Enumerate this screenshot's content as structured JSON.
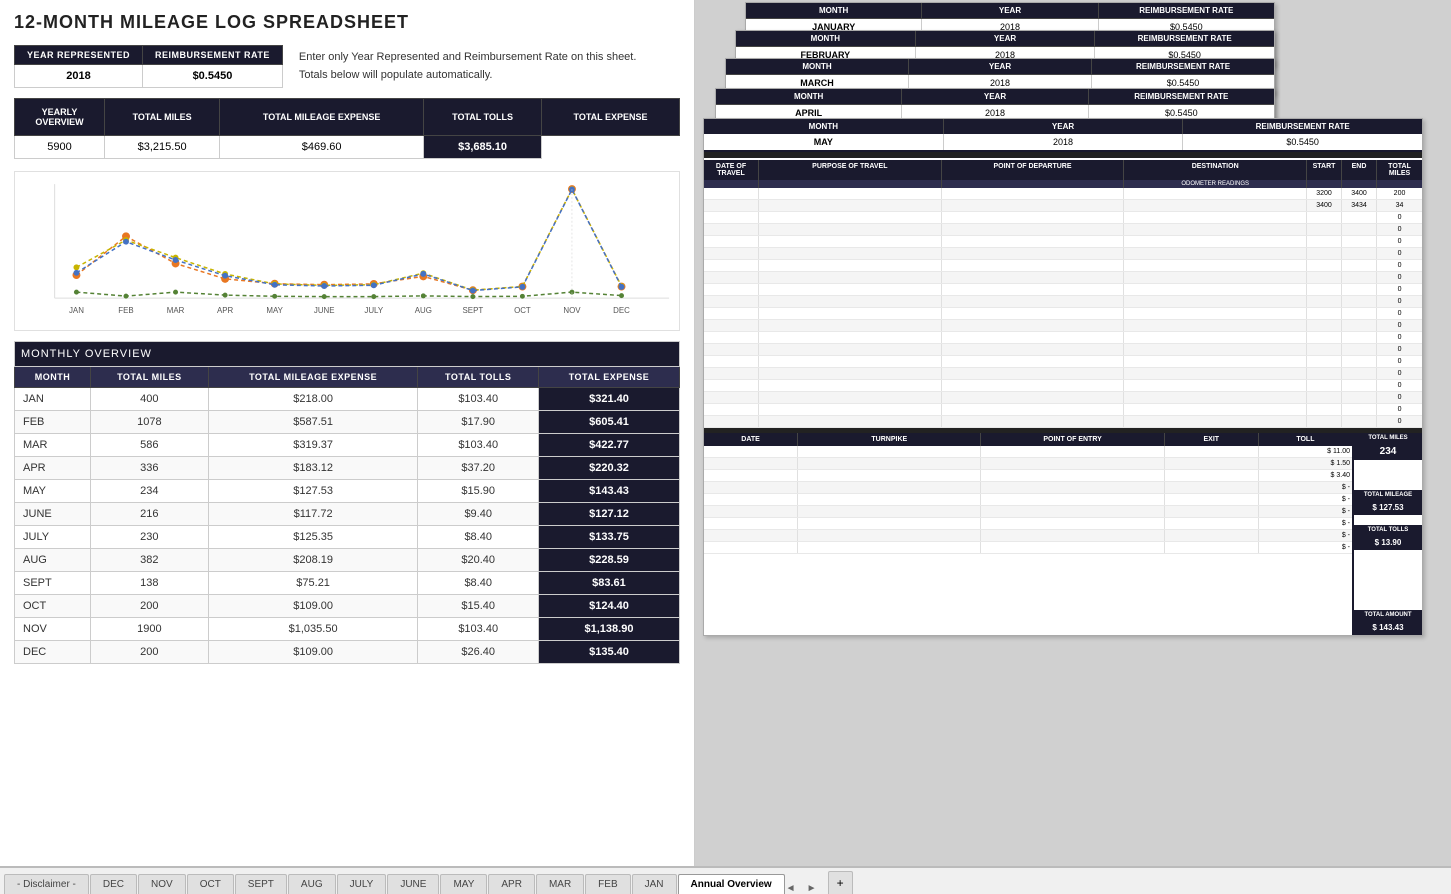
{
  "title": "12-MONTH MILEAGE LOG SPREADSHEET",
  "topInfo": {
    "yearLabel": "YEAR REPRESENTED",
    "reimbLabel": "REIMBURSEMENT RATE",
    "yearValue": "2018",
    "reimbValue": "$0.5450",
    "infoLine1": "Enter only Year Represented and Reimbursement Rate on this sheet.",
    "infoLine2": "Totals below will populate automatically."
  },
  "yearlyOverview": {
    "headers": [
      "TOTAL MILES",
      "TOTAL MILEAGE EXPENSE",
      "TOTAL TOLLS",
      "TOTAL EXPENSE"
    ],
    "rowLabel": "YEARLY OVERVIEW",
    "values": [
      "5900",
      "$3,215.50",
      "$469.60",
      "$3,685.10"
    ]
  },
  "monthlyOverview": {
    "sectionTitle": "MONTHLY OVERVIEW",
    "headers": [
      "MONTH",
      "TOTAL MILES",
      "TOTAL MILEAGE EXPENSE",
      "TOTAL TOLLS",
      "TOTAL EXPENSE"
    ],
    "rows": [
      [
        "JAN",
        "400",
        "$218.00",
        "$103.40",
        "$321.40"
      ],
      [
        "FEB",
        "1078",
        "$587.51",
        "$17.90",
        "$605.41"
      ],
      [
        "MAR",
        "586",
        "$319.37",
        "$103.40",
        "$422.77"
      ],
      [
        "APR",
        "336",
        "$183.12",
        "$37.20",
        "$220.32"
      ],
      [
        "MAY",
        "234",
        "$127.53",
        "$15.90",
        "$143.43"
      ],
      [
        "JUNE",
        "216",
        "$117.72",
        "$9.40",
        "$127.12"
      ],
      [
        "JULY",
        "230",
        "$125.35",
        "$8.40",
        "$133.75"
      ],
      [
        "AUG",
        "382",
        "$208.19",
        "$20.40",
        "$228.59"
      ],
      [
        "SEPT",
        "138",
        "$75.21",
        "$8.40",
        "$83.61"
      ],
      [
        "OCT",
        "200",
        "$109.00",
        "$15.40",
        "$124.40"
      ],
      [
        "NOV",
        "1900",
        "$1,035.50",
        "$103.40",
        "$1,138.90"
      ],
      [
        "DEC",
        "200",
        "$109.00",
        "$26.40",
        "$135.40"
      ]
    ]
  },
  "chart": {
    "months": [
      "JAN",
      "FEB",
      "MAR",
      "APR",
      "MAY",
      "JUNE",
      "JULY",
      "AUG",
      "SEPT",
      "OCT",
      "NOV",
      "DEC"
    ],
    "totalMiles": [
      400,
      1078,
      586,
      336,
      234,
      216,
      230,
      382,
      138,
      200,
      1900,
      200
    ],
    "totalMileageExpense": [
      218.0,
      587.51,
      319.37,
      183.12,
      127.53,
      117.72,
      125.35,
      208.19,
      75.21,
      109.0,
      1035.5,
      109.0
    ],
    "totalTolls": [
      103.4,
      17.9,
      103.4,
      37.2,
      15.9,
      9.4,
      8.4,
      20.4,
      8.4,
      15.4,
      103.4,
      26.4
    ],
    "totalExpense": [
      321.4,
      605.41,
      422.77,
      220.32,
      143.43,
      127.12,
      133.75,
      228.59,
      83.61,
      124.4,
      1138.9,
      135.4
    ]
  },
  "monthSheets": [
    {
      "month": "JANUARY",
      "year": "2018",
      "rate": "$0.5450"
    },
    {
      "month": "FEBRUARY",
      "year": "2018",
      "rate": "$0.5450"
    },
    {
      "month": "MARCH",
      "year": "2018",
      "rate": "$0.5450"
    },
    {
      "month": "APRIL",
      "year": "2018",
      "rate": "$0.5450"
    },
    {
      "month": "MAY",
      "year": "2018",
      "rate": "$0.5450",
      "travelHeaders": [
        "DATE OF TRAVEL",
        "PURPOSE OF TRAVEL",
        "POINT OF DEPARTURE",
        "DESTINATION",
        "START",
        "END",
        "TOTAL MILES"
      ],
      "travelRows": [
        [
          "",
          "",
          "",
          "",
          "3200",
          "3400",
          "200"
        ],
        [
          "",
          "",
          "",
          "",
          "3400",
          "3434",
          "34"
        ],
        [
          "",
          "",
          "",
          "",
          "",
          "",
          "0"
        ],
        [
          "",
          "",
          "",
          "",
          "",
          "",
          "0"
        ],
        [
          "",
          "",
          "",
          "",
          "",
          "",
          "0"
        ],
        [
          "",
          "",
          "",
          "",
          "",
          "",
          "0"
        ],
        [
          "",
          "",
          "",
          "",
          "",
          "",
          "0"
        ],
        [
          "",
          "",
          "",
          "",
          "",
          "",
          "0"
        ],
        [
          "",
          "",
          "",
          "",
          "",
          "",
          "0"
        ],
        [
          "",
          "",
          "",
          "",
          "",
          "",
          "0"
        ],
        [
          "",
          "",
          "",
          "",
          "",
          "",
          "0"
        ],
        [
          "",
          "",
          "",
          "",
          "",
          "",
          "0"
        ],
        [
          "",
          "",
          "",
          "",
          "",
          "",
          "0"
        ],
        [
          "",
          "",
          "",
          "",
          "",
          "",
          "0"
        ],
        [
          "",
          "",
          "",
          "",
          "",
          "",
          "0"
        ],
        [
          "",
          "",
          "",
          "",
          "",
          "",
          "0"
        ],
        [
          "",
          "",
          "",
          "",
          "",
          "",
          "0"
        ],
        [
          "",
          "",
          "",
          "",
          "",
          "",
          "0"
        ],
        [
          "",
          "",
          "",
          "",
          "",
          "",
          "0"
        ],
        [
          "",
          "",
          "",
          "",
          "",
          "",
          "0"
        ]
      ],
      "tollHeaders": [
        "DATE",
        "TURNPIKE",
        "POINT OF ENTRY",
        "EXIT",
        "TOLL"
      ],
      "tollRows": [
        [
          "",
          "",
          "",
          "",
          "$ 11.00"
        ],
        [
          "",
          "",
          "",
          "",
          "$ 1.50"
        ],
        [
          "",
          "",
          "",
          "",
          "$ 3.40"
        ],
        [
          "",
          "",
          "",
          "",
          "$ -"
        ],
        [
          "",
          "",
          "",
          "",
          "$ -"
        ],
        [
          "",
          "",
          "",
          "",
          "$ -"
        ],
        [
          "",
          "",
          "",
          "",
          "$ -"
        ],
        [
          "",
          "",
          "",
          "",
          "$ -"
        ],
        [
          "",
          "",
          "",
          "",
          "$ -"
        ]
      ],
      "summaryLabels": {
        "totalMilesLabel": "TOTAL MILES",
        "totalMilesValue": "234",
        "totalMileageLabel": "TOTAL MILEAGE",
        "totalMileageValue": "$ 127.53",
        "totalTollsLabel": "TOTAL TOLLS",
        "totalTollsValue": "$ 13.90",
        "totalAmountLabel": "TOTAL AMOUNT",
        "totalAmountValue": "$ 143.43"
      }
    }
  ],
  "tabs": [
    {
      "label": "Annual Overview",
      "active": true
    },
    {
      "label": "JAN",
      "active": false
    },
    {
      "label": "FEB",
      "active": false
    },
    {
      "label": "MAR",
      "active": false
    },
    {
      "label": "APR",
      "active": false
    },
    {
      "label": "MAY",
      "active": false
    },
    {
      "label": "JUNE",
      "active": false
    },
    {
      "label": "JULY",
      "active": false
    },
    {
      "label": "AUG",
      "active": false
    },
    {
      "label": "SEPT",
      "active": false
    },
    {
      "label": "OCT",
      "active": false
    },
    {
      "label": "NOV",
      "active": false
    },
    {
      "label": "DEC",
      "active": false
    },
    {
      "label": "- Disclaimer -",
      "active": false
    }
  ]
}
